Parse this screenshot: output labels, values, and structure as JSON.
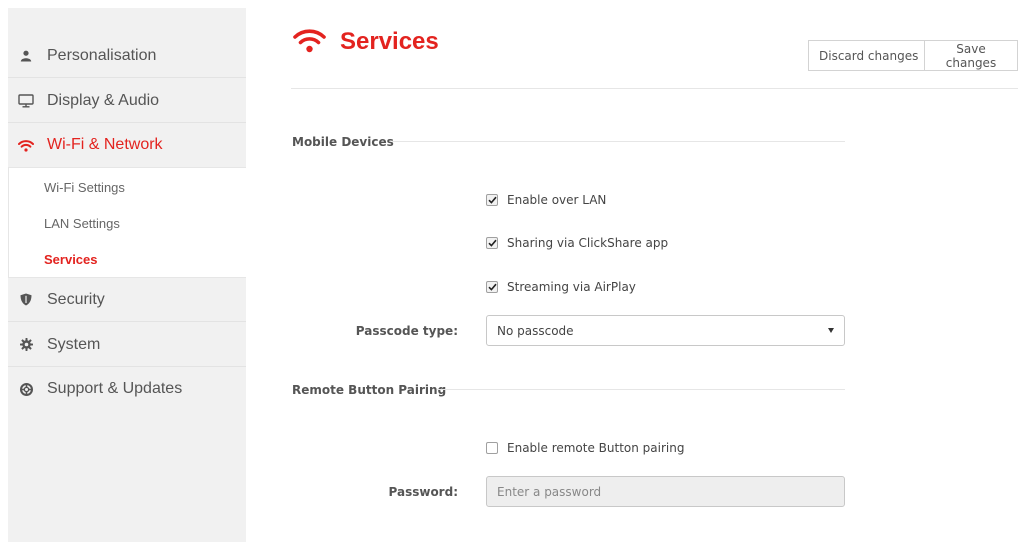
{
  "sidebar": {
    "items": [
      {
        "label": "Personalisation",
        "icon": "user-icon"
      },
      {
        "label": "Display & Audio",
        "icon": "monitor-icon"
      },
      {
        "label": "Wi-Fi & Network",
        "icon": "wifi-icon",
        "active": true
      },
      {
        "label": "Security",
        "icon": "shield-icon"
      },
      {
        "label": "System",
        "icon": "gear-icon"
      },
      {
        "label": "Support & Updates",
        "icon": "lifebuoy-icon"
      }
    ],
    "subitems": [
      {
        "label": "Wi-Fi Settings"
      },
      {
        "label": "LAN Settings"
      },
      {
        "label": "Services",
        "active": true
      }
    ]
  },
  "header": {
    "title": "Services",
    "title_icon": "wifi-icon",
    "discard_label": "Discard changes",
    "save_label": "Save changes"
  },
  "mobile_devices": {
    "section_title": "Mobile Devices",
    "options": [
      {
        "label": "Enable over LAN",
        "checked": true
      },
      {
        "label": "Sharing via ClickShare app",
        "checked": true
      },
      {
        "label": "Streaming via AirPlay",
        "checked": true
      }
    ],
    "passcode_label": "Passcode type:",
    "passcode_value": "No passcode"
  },
  "remote_button": {
    "section_title": "Remote Button Pairing",
    "enable_label": "Enable remote Button pairing",
    "enable_checked": false,
    "password_label": "Password:",
    "password_placeholder": "Enter a password",
    "password_value": ""
  },
  "colors": {
    "accent": "#e3231f",
    "sidebar_bg": "#f1f1f1",
    "text": "#4a4a4a"
  }
}
